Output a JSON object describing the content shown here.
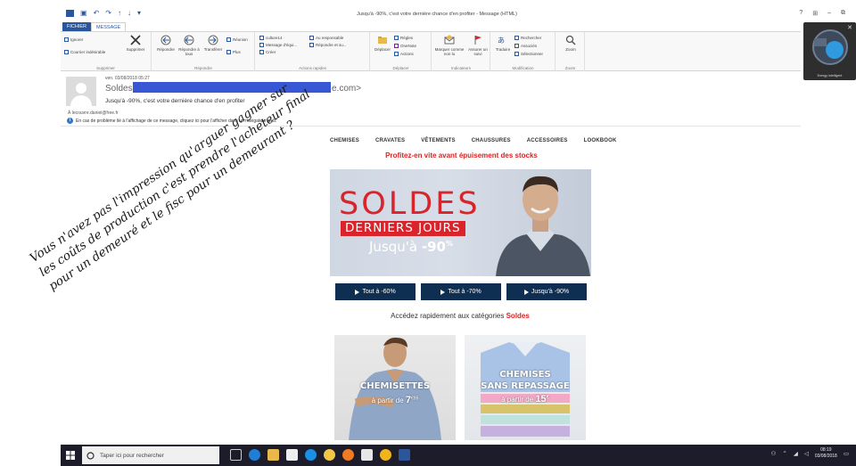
{
  "window": {
    "title": "Jusqu'à -90%, c'est votre dernière chance d'en profiter - Message (HTML)",
    "controls": [
      "?",
      "⊞",
      "–",
      "⧉"
    ]
  },
  "quick_access": [
    "save-icon",
    "undo-icon",
    "redo-icon",
    "up-icon",
    "down-icon",
    "more-icon"
  ],
  "ribbon": {
    "tabs": [
      {
        "label": "FICHIER"
      },
      {
        "label": "MESSAGE"
      }
    ],
    "groups": {
      "supprimer": {
        "label": "Supprimer",
        "ignorer": "Ignorer",
        "courrier_indesirable": "Courrier indésirable",
        "supprimer_btn": "Supprimer"
      },
      "repondre": {
        "label": "Répondre",
        "repondre": "Répondre",
        "repondre_tous": "Répondre à tous",
        "transferer": "Transférer",
        "reunion": "Réunion",
        "plus": "Plus"
      },
      "actions_rapides": {
        "label": "Actions rapides",
        "items": [
          "culture14",
          "Message d'équi...",
          "Créer",
          "Au responsable",
          "Répondre et su..."
        ]
      },
      "deplacer": {
        "label": "Déplacer",
        "deplacer": "Déplacer",
        "regles": "Règles",
        "onenote": "OneNote",
        "actions": "Actions"
      },
      "indicateurs": {
        "label": "Indicateurs",
        "marquer_non_lu": "Marquer comme non lu",
        "assurer_suivi": "Assurer un suivi"
      },
      "modification": {
        "label": "Modification",
        "traduire": "Traduire",
        "rechercher": "Rechercher",
        "associes": "Associés",
        "selectionner": "Sélectionner"
      },
      "zoom": {
        "label": "Zoom",
        "zoom": "Zoom"
      }
    }
  },
  "message": {
    "sent": "ven. 03/08/2018 05:27",
    "sender_visible": "Soldes",
    "sender_domain": "e.com>",
    "subject": "Jusqu'à -90%, c'est votre dernière chance d'en profiter",
    "to": "À    lecouvre.daniel@free.fr",
    "info": "En cas de problème lié à l'affichage de ce message, cliquez ici pour l'afficher dans un navigateur web."
  },
  "newsletter": {
    "nav": [
      "CHEMISES",
      "CRAVATES",
      "VÊTEMENTS",
      "CHAUSSURES",
      "ACCESSOIRES",
      "LOOKBOOK"
    ],
    "promo": "Profitez-en vite avant épuisement des stocks",
    "hero": {
      "title": "SOLDES",
      "subtitle": "DERNIERS JOURS",
      "jusqua_prefix": "Jusqu'à ",
      "jusqua_value": "-90",
      "jusqua_pct": "%"
    },
    "cta": [
      {
        "label": "Tout à -60%"
      },
      {
        "label": "Tout à -70%"
      },
      {
        "label": "Jusqu'à -90%"
      }
    ],
    "quick_access_prefix": "Accédez rapidement aux catégories",
    "quick_access_highlight": "Soldes",
    "tiles": [
      {
        "title": "CHEMISETTES",
        "sub_prefix": "à partir de ",
        "price": "7",
        "price_sup": "€95"
      },
      {
        "title_line1": "CHEMISES",
        "title_line2": "SANS REPASSAGE",
        "sub_prefix": "à partir de ",
        "price": "15",
        "price_sup": "€"
      }
    ]
  },
  "note": {
    "lines": [
      "Vous n'avez pas l'impression qu'arguer gagner sur",
      "les coûts de production c'est prendre l'acheteur final",
      "pour un demeuré et le fisc pour un demeurant ?"
    ]
  },
  "widget": {
    "caption": "Energy Intelligent"
  },
  "taskbar": {
    "search_placeholder": "Taper ici pour rechercher",
    "time": "08:19",
    "date": "03/08/2018",
    "icons": [
      "task-view-icon",
      "edge-icon",
      "explorer-icon",
      "store-icon",
      "app-icon",
      "app2-icon",
      "firefox-icon",
      "mail-icon",
      "chrome-icon",
      "outlook-icon"
    ]
  },
  "colors": {
    "outlook_blue": "#2b579a",
    "brand_red": "#d9242c",
    "cta_navy": "#0e2f52",
    "redaction_blue": "#3757d4",
    "taskbar": "#1c1c2b"
  }
}
